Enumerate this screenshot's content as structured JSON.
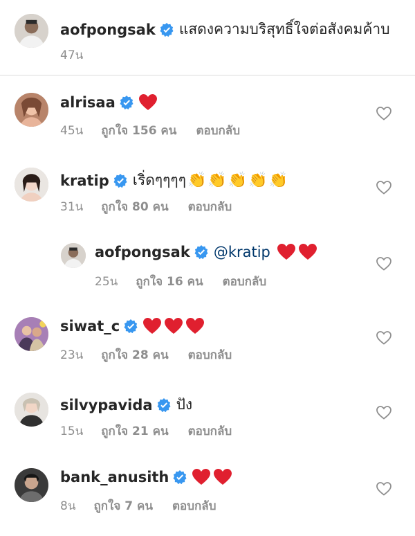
{
  "caption": {
    "username": "aofpongsak",
    "text": "แสดงความบริสุทธิ์ใจต่อสังคมค้าบ",
    "time": "47น"
  },
  "comments": [
    {
      "username": "alrisaa",
      "text": "",
      "hearts": 1,
      "claps": 0,
      "time": "45น",
      "likes": "ถูกใจ 156 คน",
      "reply": "ตอบกลับ"
    },
    {
      "username": "kratip",
      "text": "เริ่ดๆๆๆๆ",
      "hearts": 0,
      "claps": 5,
      "time": "31น",
      "likes": "ถูกใจ 80 คน",
      "reply": "ตอบกลับ"
    },
    {
      "username": "aofpongsak",
      "mention": "@kratip",
      "hearts": 2,
      "claps": 0,
      "time": "25น",
      "likes": "ถูกใจ 16 คน",
      "reply": "ตอบกลับ"
    },
    {
      "username": "siwat_c",
      "text": "",
      "hearts": 3,
      "claps": 0,
      "time": "23น",
      "likes": "ถูกใจ 28 คน",
      "reply": "ตอบกลับ"
    },
    {
      "username": "silvypavida",
      "text": "ปัง",
      "hearts": 0,
      "claps": 0,
      "time": "15น",
      "likes": "ถูกใจ 21 คน",
      "reply": "ตอบกลับ"
    },
    {
      "username": "bank_anusith",
      "text": "",
      "hearts": 2,
      "claps": 0,
      "time": "8น",
      "likes": "ถูกใจ 7 คน",
      "reply": "ตอบกลับ"
    }
  ],
  "icons": {
    "verified": "verified-badge-icon",
    "like": "heart-outline-icon",
    "emoji_heart": "red-heart-emoji",
    "emoji_clap": "clapping-hands-emoji"
  },
  "colors": {
    "verified": "#3897f0",
    "heart": "#ed4956",
    "meta": "#8e8e8e",
    "mention": "#00376b"
  }
}
